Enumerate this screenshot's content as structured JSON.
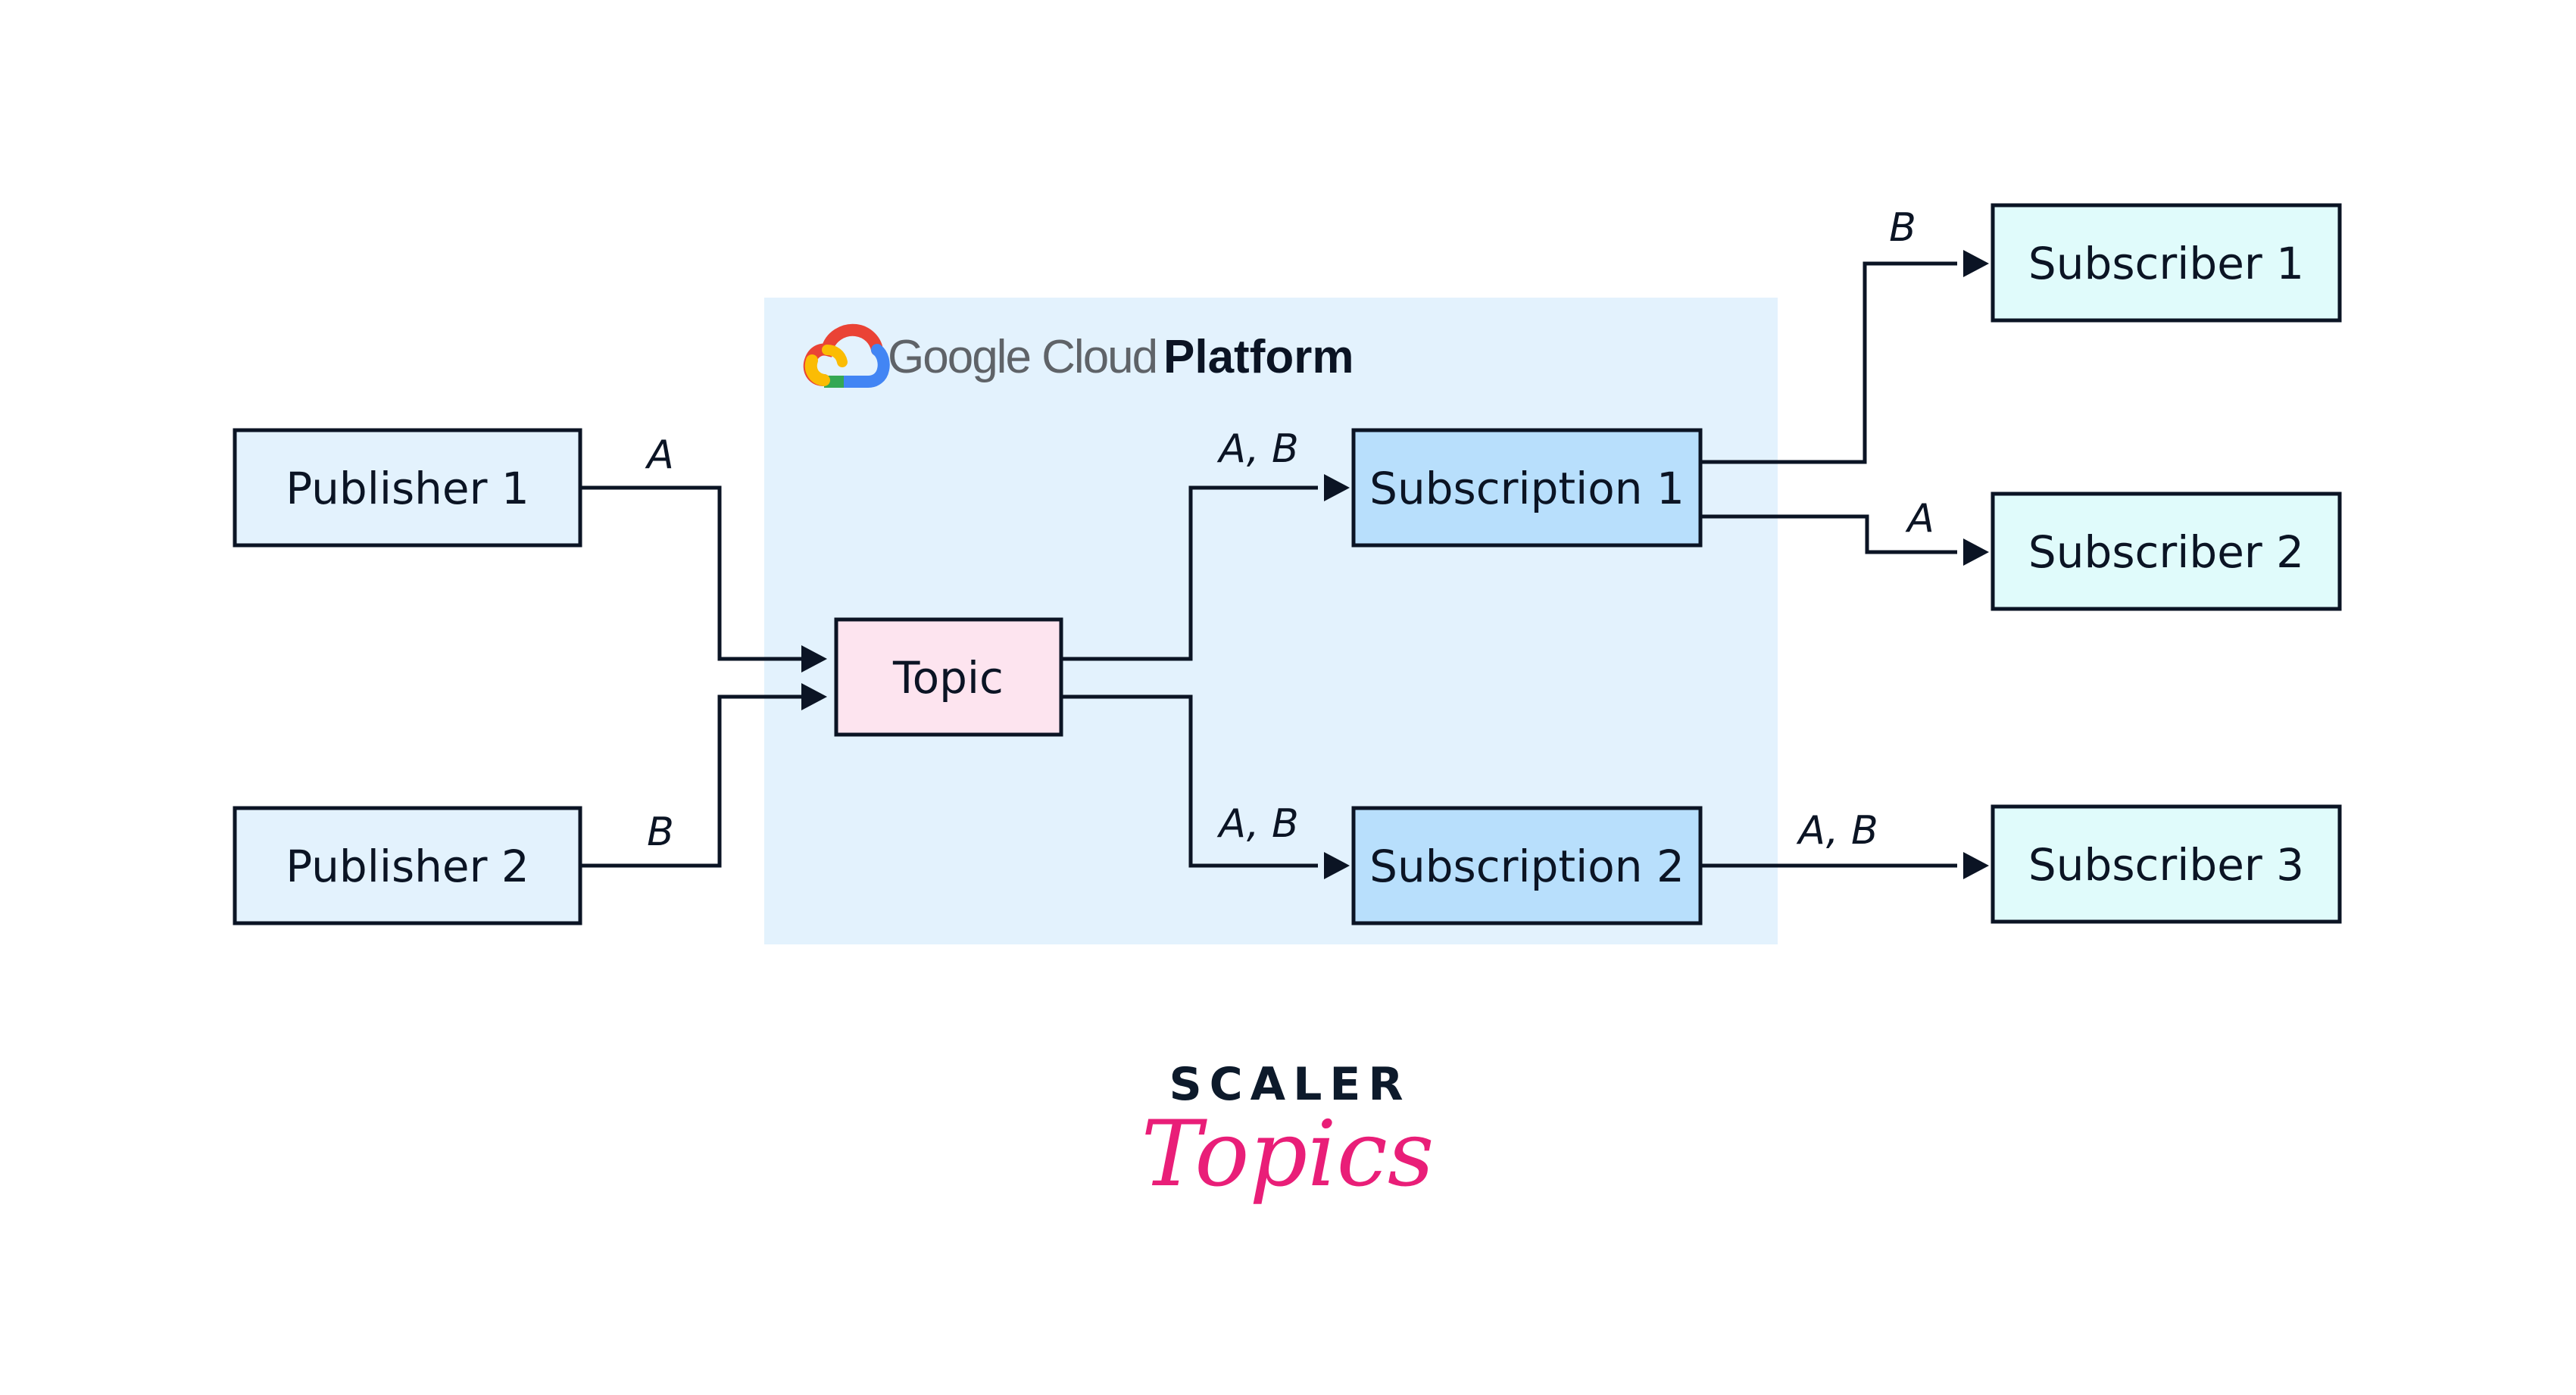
{
  "platform": {
    "brand_google_cloud": "Google Cloud",
    "brand_platform": "Platform",
    "logo_icon": "google-cloud-logo-icon",
    "colors": {
      "panel_bg": "#e3f2fd",
      "red": "#ea4335",
      "blue": "#4285f4",
      "yellow": "#fbbc04",
      "green": "#34a853"
    }
  },
  "nodes": {
    "publisher1": {
      "label": "Publisher 1",
      "fill": "#e3f2fd"
    },
    "publisher2": {
      "label": "Publisher 2",
      "fill": "#e3f2fd"
    },
    "topic": {
      "label": "Topic",
      "fill": "#fde4ef"
    },
    "subscription1": {
      "label": "Subscription 1",
      "fill": "#b8dffc"
    },
    "subscription2": {
      "label": "Subscription 2",
      "fill": "#b8dffc"
    },
    "subscriber1": {
      "label": "Subscriber 1",
      "fill": "#e0fbfb"
    },
    "subscriber2": {
      "label": "Subscriber 2",
      "fill": "#e0fbfb"
    },
    "subscriber3": {
      "label": "Subscriber 3",
      "fill": "#e0fbfb"
    }
  },
  "edges": {
    "pub1_topic": {
      "from": "Publisher 1",
      "to": "Topic",
      "label": "A"
    },
    "pub2_topic": {
      "from": "Publisher 2",
      "to": "Topic",
      "label": "B"
    },
    "topic_sub1": {
      "from": "Topic",
      "to": "Subscription 1",
      "label": "A, B"
    },
    "topic_sub2": {
      "from": "Topic",
      "to": "Subscription 2",
      "label": "A, B"
    },
    "sub1_subscriber1": {
      "from": "Subscription 1",
      "to": "Subscriber 1",
      "label": "B"
    },
    "sub1_subscriber2": {
      "from": "Subscription 1",
      "to": "Subscriber 2",
      "label": "A"
    },
    "sub2_subscriber3": {
      "from": "Subscription 2",
      "to": "Subscriber 3",
      "label": "A, B"
    }
  },
  "footer": {
    "brand_top": "SCALER",
    "brand_bottom": "Topics",
    "brand_color": "#e91e78"
  }
}
